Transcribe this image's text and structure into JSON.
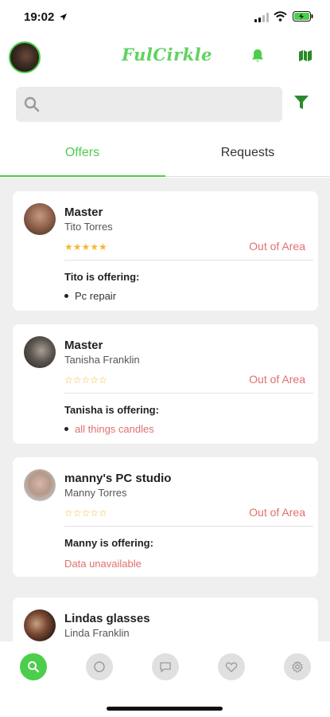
{
  "status_bar": {
    "time": "19:02"
  },
  "header": {
    "brand": "FulCirkle"
  },
  "search": {
    "placeholder": "",
    "value": ""
  },
  "tabs": [
    {
      "label": "Offers",
      "active": true
    },
    {
      "label": "Requests",
      "active": false
    }
  ],
  "cards": [
    {
      "title": "Master",
      "subtitle": "Tito Torres",
      "rating": 5,
      "area_status": "Out of Area",
      "offering_heading": "Tito is offering:",
      "items": [
        "Pc repair"
      ],
      "item_style": "plain"
    },
    {
      "title": "Master",
      "subtitle": "Tanisha Franklin",
      "rating": 0,
      "area_status": "Out of Area",
      "offering_heading": "Tanisha is offering:",
      "items": [
        "all things candles"
      ],
      "item_style": "link"
    },
    {
      "title": "manny's PC studio",
      "subtitle": "Manny Torres",
      "rating": 0,
      "area_status": "Out of Area",
      "offering_heading": "Manny is offering:",
      "unavailable_text": "Data unavailable"
    },
    {
      "title": "Lindas glasses",
      "subtitle": "Linda Franklin"
    }
  ],
  "bottom_nav": [
    {
      "icon": "search-icon",
      "active": true
    },
    {
      "icon": "circle-icon",
      "active": false
    },
    {
      "icon": "chat-icon",
      "active": false
    },
    {
      "icon": "heart-icon",
      "active": false
    },
    {
      "icon": "gear-icon",
      "active": false
    }
  ],
  "colors": {
    "accent": "#4ccd4c",
    "warning_text": "#e1706e",
    "star": "#f5b82e",
    "list_background": "#efefef"
  }
}
